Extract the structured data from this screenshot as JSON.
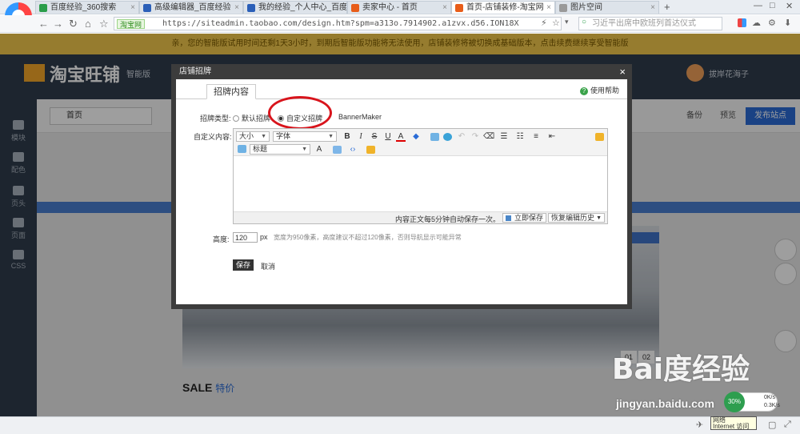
{
  "browser": {
    "tabs": [
      {
        "label": "百度经验_360搜索",
        "color": "#2a9d4a",
        "active": false
      },
      {
        "label": "高级编辑器_百度经验",
        "color": "#2b5fb8",
        "active": false
      },
      {
        "label": "我的经验_个人中心_百度经验",
        "color": "#2b5fb8",
        "active": false
      },
      {
        "label": "卖家中心 - 首页",
        "color": "#e85d1a",
        "active": false
      },
      {
        "label": "首页-店铺装修-淘宝网",
        "color": "#e85d1a",
        "active": true
      },
      {
        "label": "图片空间",
        "color": "#999999",
        "active": false
      }
    ],
    "site_badge": "淘宝网",
    "url": "https://siteadmin.taobao.com/design.htm?spm=a313o.7914902.a1zvx.d56.ION18X",
    "search_placeholder": "习近平出席中欧班列首达仪式",
    "new_tab": "+",
    "win_min": "—",
    "win_max": "□",
    "win_close": "✕"
  },
  "shop": {
    "notice": "亲，您的智能版试用时间还剩1天3小时，到期后智能版功能将无法使用，店铺装修将被切换成基础版本，点击续费继续享受智能版",
    "logo_text": "淘宝旺铺",
    "version": "智能版",
    "user": "拔岸花海子",
    "rail": [
      "模块",
      "配色",
      "页头",
      "页面",
      "CSS"
    ],
    "page_select": "首页",
    "backup": "备份",
    "preview": "预览",
    "publish": "发布站点",
    "slide_dots": [
      "01",
      "02"
    ],
    "sale_title": "SALE",
    "sale_sub": "特价"
  },
  "dialog": {
    "title": "店铺招牌",
    "close": "×",
    "tab": "招牌内容",
    "help": "使用帮助",
    "type_label": "招牌类型:",
    "types": [
      {
        "label": "默认招牌",
        "checked": false
      },
      {
        "label": "自定义招牌",
        "checked": true
      },
      {
        "label": "BannerMaker",
        "checked": false
      }
    ],
    "content_label": "自定义内容:",
    "editor": {
      "size_select": "大小",
      "font_select": "字体",
      "heading_select": "标题",
      "bold": "B",
      "italic": "I",
      "strike": "S",
      "underline": "U",
      "autosave": "内容正文每5分钟自动保存一次。",
      "save_now": "立即保存",
      "history": "恢复编辑历史"
    },
    "height_label": "高度:",
    "height_value": "120",
    "height_unit": "px",
    "height_hint": "宽度为950像素，高度建议不超过120像素，否则导航显示可能异常",
    "save": "保存",
    "cancel": "取消"
  },
  "status": {
    "speed_percent": "30%",
    "speed_up": "0K/s",
    "speed_down": "0.3K/s",
    "net_tooltip_1": "网络",
    "net_tooltip_2": "Internet 访问"
  },
  "watermark": {
    "brand": "Bai度经验",
    "url": "jingyan.baidu.com"
  },
  "colors": {
    "accent_red": "#d8141c",
    "publish_blue": "#2a6bd6",
    "notice_yellow": "#f2c94c"
  }
}
